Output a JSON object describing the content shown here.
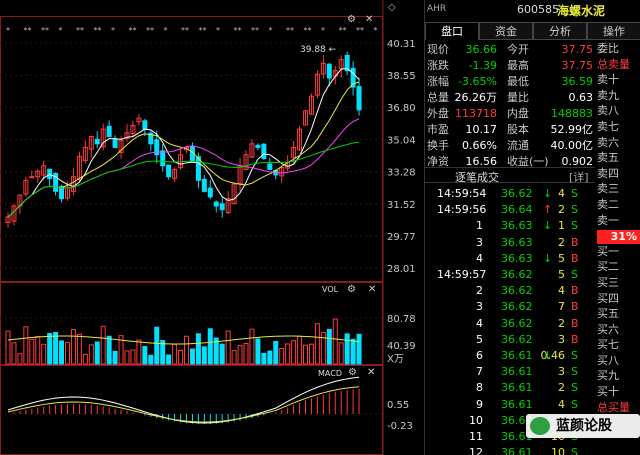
{
  "header": {
    "ahr": "AHR",
    "code": "600585",
    "name": "海螺水泥"
  },
  "tabs": [
    "盘口",
    "资金",
    "分析",
    "操作"
  ],
  "stats": [
    {
      "l1": "现价",
      "v1": "36.66",
      "l2": "今开",
      "v2": "37.75"
    },
    {
      "l1": "涨跌",
      "v1": "-1.39",
      "l2": "最高",
      "v2": "37.75"
    },
    {
      "l1": "涨幅",
      "v1": "-3.65%",
      "l2": "最低",
      "v2": "36.59"
    },
    {
      "l1": "总量",
      "v1": "26.26万",
      "l2": "量比",
      "v2": "0.63"
    },
    {
      "l1": "外盘",
      "v1": "113718",
      "l2": "内盘",
      "v2": "148883"
    },
    {
      "l1": "市盈",
      "v1": "10.17",
      "l2": "股本",
      "v2": "52.99亿"
    },
    {
      "l1": "换手",
      "v1": "0.66%",
      "l2": "流通",
      "v2": "40.00亿"
    },
    {
      "l1": "净资",
      "v1": "16.56",
      "l2": "收益(一)",
      "v2": "0.902"
    }
  ],
  "side": [
    "委比",
    "总卖量",
    "卖十",
    "卖九",
    "卖八",
    "卖七",
    "卖六",
    "卖五",
    "卖四",
    "卖三",
    "卖二",
    "卖一",
    "",
    "买一",
    "买二",
    "买三",
    "买四",
    "买五",
    "买六",
    "买七",
    "买八",
    "买九",
    "买十",
    "总买量"
  ],
  "weibi_pct": "31%",
  "tick_header": {
    "title": "逐笔成交",
    "detail": "[详]"
  },
  "ticks": [
    {
      "t": "14:59:54",
      "p": "36.62",
      "a": "↓",
      "v": "4",
      "s": "S"
    },
    {
      "t": "14:59:56",
      "p": "36.64",
      "a": "↑",
      "v": "2",
      "s": "S"
    },
    {
      "t": "1",
      "p": "36.63",
      "a": "↓",
      "v": "1",
      "s": "S"
    },
    {
      "t": "3",
      "p": "36.63",
      "a": "",
      "v": "2",
      "s": "B"
    },
    {
      "t": "4",
      "p": "36.63",
      "a": "↓",
      "v": "5",
      "s": "B"
    },
    {
      "t": "14:59:57",
      "p": "36.62",
      "a": "",
      "v": "5",
      "s": "S"
    },
    {
      "t": "2",
      "p": "36.62",
      "a": "",
      "v": "4",
      "s": "B"
    },
    {
      "t": "3",
      "p": "36.62",
      "a": "",
      "v": "7",
      "s": "B"
    },
    {
      "t": "4",
      "p": "36.62",
      "a": "",
      "v": "2",
      "s": "B"
    },
    {
      "t": "5",
      "p": "36.62",
      "a": "",
      "v": "3",
      "s": "B"
    },
    {
      "t": "6",
      "p": "36.61",
      "a": "↓",
      "v": "0.46",
      "s": "S"
    },
    {
      "t": "7",
      "p": "36.61",
      "a": "",
      "v": "3",
      "s": "S"
    },
    {
      "t": "8",
      "p": "36.61",
      "a": "",
      "v": "2",
      "s": "S"
    },
    {
      "t": "9",
      "p": "36.61",
      "a": "",
      "v": "4",
      "s": "S"
    },
    {
      "t": "10",
      "p": "36.61",
      "a": "",
      "v": "5",
      "s": "S"
    },
    {
      "t": "11",
      "p": "36.61",
      "a": "",
      "v": "10",
      "s": "S"
    },
    {
      "t": "12",
      "p": "36.61",
      "a": "",
      "v": "10",
      "s": "S"
    }
  ],
  "price_axis": [
    "40.31",
    "38.55",
    "36.80",
    "35.04",
    "33.28",
    "31.52",
    "29.77",
    "28.01"
  ],
  "max_label": "39.88",
  "vol_title": "VOL",
  "vol_axis": [
    "80.78",
    "40.39",
    "X万"
  ],
  "macd_title": "MACD",
  "macd_axis": [
    "0.55",
    "-0.23"
  ],
  "logo_text": "蓝颜论股",
  "colors": {
    "up": "#ff3b3b",
    "down": "#00e0ff",
    "ma5": "#ffffff",
    "ma10": "#e8e840",
    "ma20": "#ff40ff",
    "ma60": "#00d000"
  }
}
